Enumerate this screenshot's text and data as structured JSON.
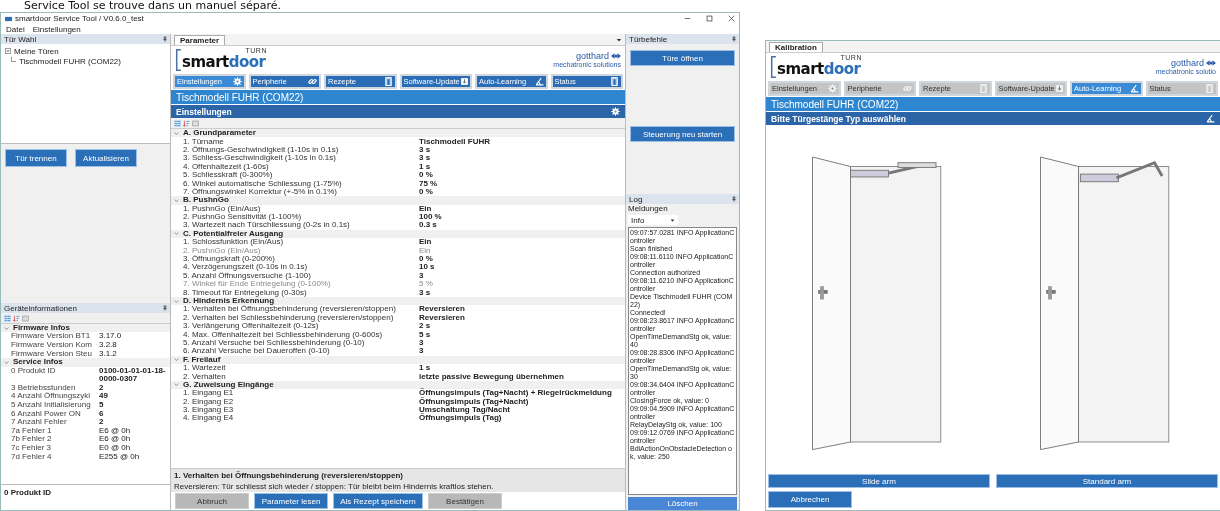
{
  "heading": "Service Tool se trouve dans un manuel séparé.",
  "window": {
    "title": "smartdoor Service Tool / V0.6.0_test",
    "menu": [
      "Datei",
      "Einstellungen"
    ]
  },
  "door_panel": {
    "title": "Tür Wahl",
    "tree": [
      {
        "label": "Meine Türen",
        "expanded": true,
        "children": [
          {
            "label": "Tischmodell FUHR (COM22)"
          }
        ]
      }
    ],
    "buttons": [
      "Tür trennen",
      "Aktualisieren"
    ]
  },
  "device_info": {
    "title": "Geräteinformationen",
    "groups": [
      {
        "label": "Firmware Infos",
        "expanded": true,
        "rows": [
          {
            "name": "Firmware Version BT1",
            "value": "3.17.0",
            "bold": false
          },
          {
            "name": "Firmware Version Kom",
            "value": "3.2.8",
            "bold": false
          },
          {
            "name": "Firmware Version Steu",
            "value": "3.1.2",
            "bold": false
          }
        ]
      },
      {
        "label": "Service Infos",
        "expanded": true,
        "rows": [
          {
            "name": "0 Produkt ID",
            "value": "0100-01-01-01-18-0000-0307",
            "bold": true
          },
          {
            "name": "3 Betriebsstunden",
            "value": "2",
            "bold": true
          },
          {
            "name": "4 Anzahl Öffnungszykl",
            "value": "49",
            "bold": true
          },
          {
            "name": "5 Anzahl Initialisierung",
            "value": "5",
            "bold": true
          },
          {
            "name": "6 Anzahl Power ON",
            "value": "6",
            "bold": true
          },
          {
            "name": "7 Anzahl Fehler",
            "value": "2",
            "bold": true
          },
          {
            "name": "7a Fehler 1",
            "value": "E6 @ 0h",
            "bold": false
          },
          {
            "name": "7b Fehler 2",
            "value": "E6 @ 0h",
            "bold": false
          },
          {
            "name": "7c Fehler 3",
            "value": "E0 @ 0h",
            "bold": false
          },
          {
            "name": "7d Fehler 4",
            "value": "E255 @ 0h",
            "bold": false
          }
        ]
      }
    ],
    "footer": "0 Produkt ID"
  },
  "parameter_panel": {
    "tab": "Parameter",
    "logo": {
      "prefix": "smart",
      "suffix": "door",
      "tag": "TURN",
      "partner": "gotthard",
      "partner_tagline": "mechatronic solutions"
    },
    "nav": [
      {
        "label": "Einstellungen",
        "kind": "gear",
        "selected": true
      },
      {
        "label": "Peripherie",
        "kind": "link",
        "selected": false
      },
      {
        "label": "Rezepte",
        "kind": "door",
        "selected": false
      },
      {
        "label": "Software-Update",
        "kind": "download",
        "selected": false
      },
      {
        "label": "Auto-Learning",
        "kind": "angle",
        "selected": false
      },
      {
        "label": "Status",
        "kind": "door",
        "selected": false
      }
    ],
    "device_title": "Tischmodell FUHR (COM22)",
    "section_title": "Einstellungen",
    "groups": [
      {
        "label": "A. Grundparameter",
        "expanded": true,
        "rows": [
          {
            "name": "1. Türname",
            "value": "Tischmodell FUHR",
            "disabled": false
          },
          {
            "name": "2. Öffnungs-Geschwindigkeit (1-10s in 0.1s)",
            "value": "3 s",
            "disabled": false
          },
          {
            "name": "3. Schliess-Geschwindigkeit (1-10s in 0.1s)",
            "value": "3 s",
            "disabled": false
          },
          {
            "name": "4. Offenhaltezeit (1-60s)",
            "value": "1 s",
            "disabled": false
          },
          {
            "name": "5. Schliesskraft (0-300%)",
            "value": "0 %",
            "disabled": false
          },
          {
            "name": "6. Winkel automatische Schliessung (1-75%)",
            "value": "75 %",
            "disabled": false
          },
          {
            "name": "7. Öffnungswinkel Korrektur (+-5% in 0.1%)",
            "value": "0 %",
            "disabled": false
          }
        ]
      },
      {
        "label": "B. PushnGo",
        "expanded": true,
        "rows": [
          {
            "name": "1. PushnGo (Ein/Aus)",
            "value": "Ein",
            "disabled": false
          },
          {
            "name": "2. PushnGo Sensitivität (1-100%)",
            "value": "100 %",
            "disabled": false
          },
          {
            "name": "3. Wartezeit nach Türschliessung (0-2s in 0.1s)",
            "value": "0.3 s",
            "disabled": false
          }
        ]
      },
      {
        "label": "C. Potentialfreier Ausgang",
        "expanded": true,
        "rows": [
          {
            "name": "1. Schlossfunktion (Ein/Aus)",
            "value": "Ein",
            "disabled": false
          },
          {
            "name": "2. PushnGo (Ein/Aus)",
            "value": "Ein",
            "disabled": true
          },
          {
            "name": "3. Öffnungskraft (0-200%)",
            "value": "0 %",
            "disabled": false
          },
          {
            "name": "4. Verzögerungszeit (0-10s in 0.1s)",
            "value": "10 s",
            "disabled": false
          },
          {
            "name": "5. Anzahl Öffnungsversuche (1-100)",
            "value": "3",
            "disabled": false
          },
          {
            "name": "7. Winkel für Ende Entriegelung (0-100%)",
            "value": "5 %",
            "disabled": true
          },
          {
            "name": "8. Timeout für Entriegelung (0-30s)",
            "value": "3 s",
            "disabled": false
          }
        ]
      },
      {
        "label": "D. Hindernis Erkennung",
        "expanded": true,
        "rows": [
          {
            "name": "1. Verhalten bei Öffnungsbehinderung (reversieren/stoppen)",
            "value": "Reversieren",
            "disabled": false
          },
          {
            "name": "2. Verhalten bei Schliessbehinderung (reversieren/stoppen)",
            "value": "Reversieren",
            "disabled": false
          },
          {
            "name": "3. Verlängerung Offenhaltezeit (0-12s)",
            "value": "2 s",
            "disabled": false
          },
          {
            "name": "4. Max. Offenhaltezeit bei Schliessbehinderung (0-600s)",
            "value": "5 s",
            "disabled": false
          },
          {
            "name": "5. Anzahl Versuche bei Schliessbehinderung (0-10)",
            "value": "3",
            "disabled": false
          },
          {
            "name": "6. Anzahl Versuche bei Daueroffen (0-10)",
            "value": "3",
            "disabled": false
          }
        ]
      },
      {
        "label": "F. Freilauf",
        "expanded": true,
        "rows": [
          {
            "name": "1. Wartezeit",
            "value": "1 s",
            "disabled": false
          },
          {
            "name": "2. Verhalten",
            "value": "letzte passive Bewegung übernehmen",
            "disabled": false
          }
        ]
      },
      {
        "label": "G. Zuweisung Eingänge",
        "expanded": true,
        "rows": [
          {
            "name": "1. Eingang E1",
            "value": "Öffnungsimpuls (Tag+Nacht) + Riegelrückmeldung",
            "disabled": false
          },
          {
            "name": "2. Eingang E2",
            "value": "Öffnungsimpuls (Tag+Nacht)",
            "disabled": false
          },
          {
            "name": "3. Eingang E3",
            "value": "Umschaltung Tag/Nacht",
            "disabled": false
          },
          {
            "name": "4. Eingang E4",
            "value": "Öffnungsimpuls (Tag)",
            "disabled": false
          }
        ]
      }
    ],
    "description": {
      "title": "1. Verhalten bei Öffnungsbehinderung (reversieren/stoppen)",
      "text": "Reversieren: Tür schliesst sich wieder / stoppen: Tür bleibt beim Hindernis kraftlos stehen."
    },
    "buttons": [
      {
        "label": "Abbruch",
        "disabled": true
      },
      {
        "label": "Parameter lesen",
        "disabled": false
      },
      {
        "label": "Als Rezept speichern",
        "disabled": false
      },
      {
        "label": "Bestätigen",
        "disabled": true
      }
    ]
  },
  "commands": {
    "title": "Türbefehle",
    "buttons": [
      "Türe öffnen",
      "Steuerung neu starten"
    ]
  },
  "log": {
    "title": "Log",
    "filter_label": "Meldungen",
    "filter_value": "Info",
    "lines": [
      "09:07:57.0281 INFO ApplicationController",
      "Scan finished",
      "09:08:11.6110 INFO ApplicationController",
      "Connection authorized",
      "09:08:11.6210 INFO ApplicationController",
      "Device Tischmodell FUHR (COM22)",
      "Connected!",
      "09:08:23.8617 INFO ApplicationController",
      "OpenTimeDemandStg ok, value: 40",
      "09:08:28.8306 INFO ApplicationController",
      "OpenTimeDemandStg ok, value: 30",
      "09:08:34.6404 INFO ApplicationController",
      "ClosingForce ok, value: 0",
      "09:09:04.5909 INFO ApplicationController",
      "RelayDelayStg ok, value: 100",
      "09:09:12.0769 INFO ApplicationController",
      "BdiActionOnObstacleDetection ok, value: 250"
    ],
    "clear_button": "Löschen"
  },
  "calibration_window": {
    "tab": "Kalibration",
    "logo": {
      "prefix": "smart",
      "suffix": "door",
      "tag": "TURN",
      "partner": "gotthard",
      "partner_tagline": "mechatronic solutio"
    },
    "nav": [
      {
        "label": "Einstellungen",
        "kind": "gear",
        "selected": false,
        "disabled": true
      },
      {
        "label": "Peripherie",
        "kind": "link",
        "selected": false,
        "disabled": true
      },
      {
        "label": "Rezepte",
        "kind": "door",
        "selected": false,
        "disabled": true
      },
      {
        "label": "Software-Update",
        "kind": "download",
        "selected": false,
        "disabled": true
      },
      {
        "label": "Auto-Learning",
        "kind": "angle",
        "selected": true,
        "disabled": false
      },
      {
        "label": "Status",
        "kind": "door",
        "selected": false,
        "disabled": true
      }
    ],
    "device_title": "Tischmodell FUHR (COM22)",
    "section_title": "Bitte Türgestänge Typ auswählen",
    "options": [
      {
        "label": "Slide arm",
        "kind": "slide"
      },
      {
        "label": "Standard arm",
        "kind": "standard"
      }
    ],
    "cancel_button": "Abbrechen"
  }
}
